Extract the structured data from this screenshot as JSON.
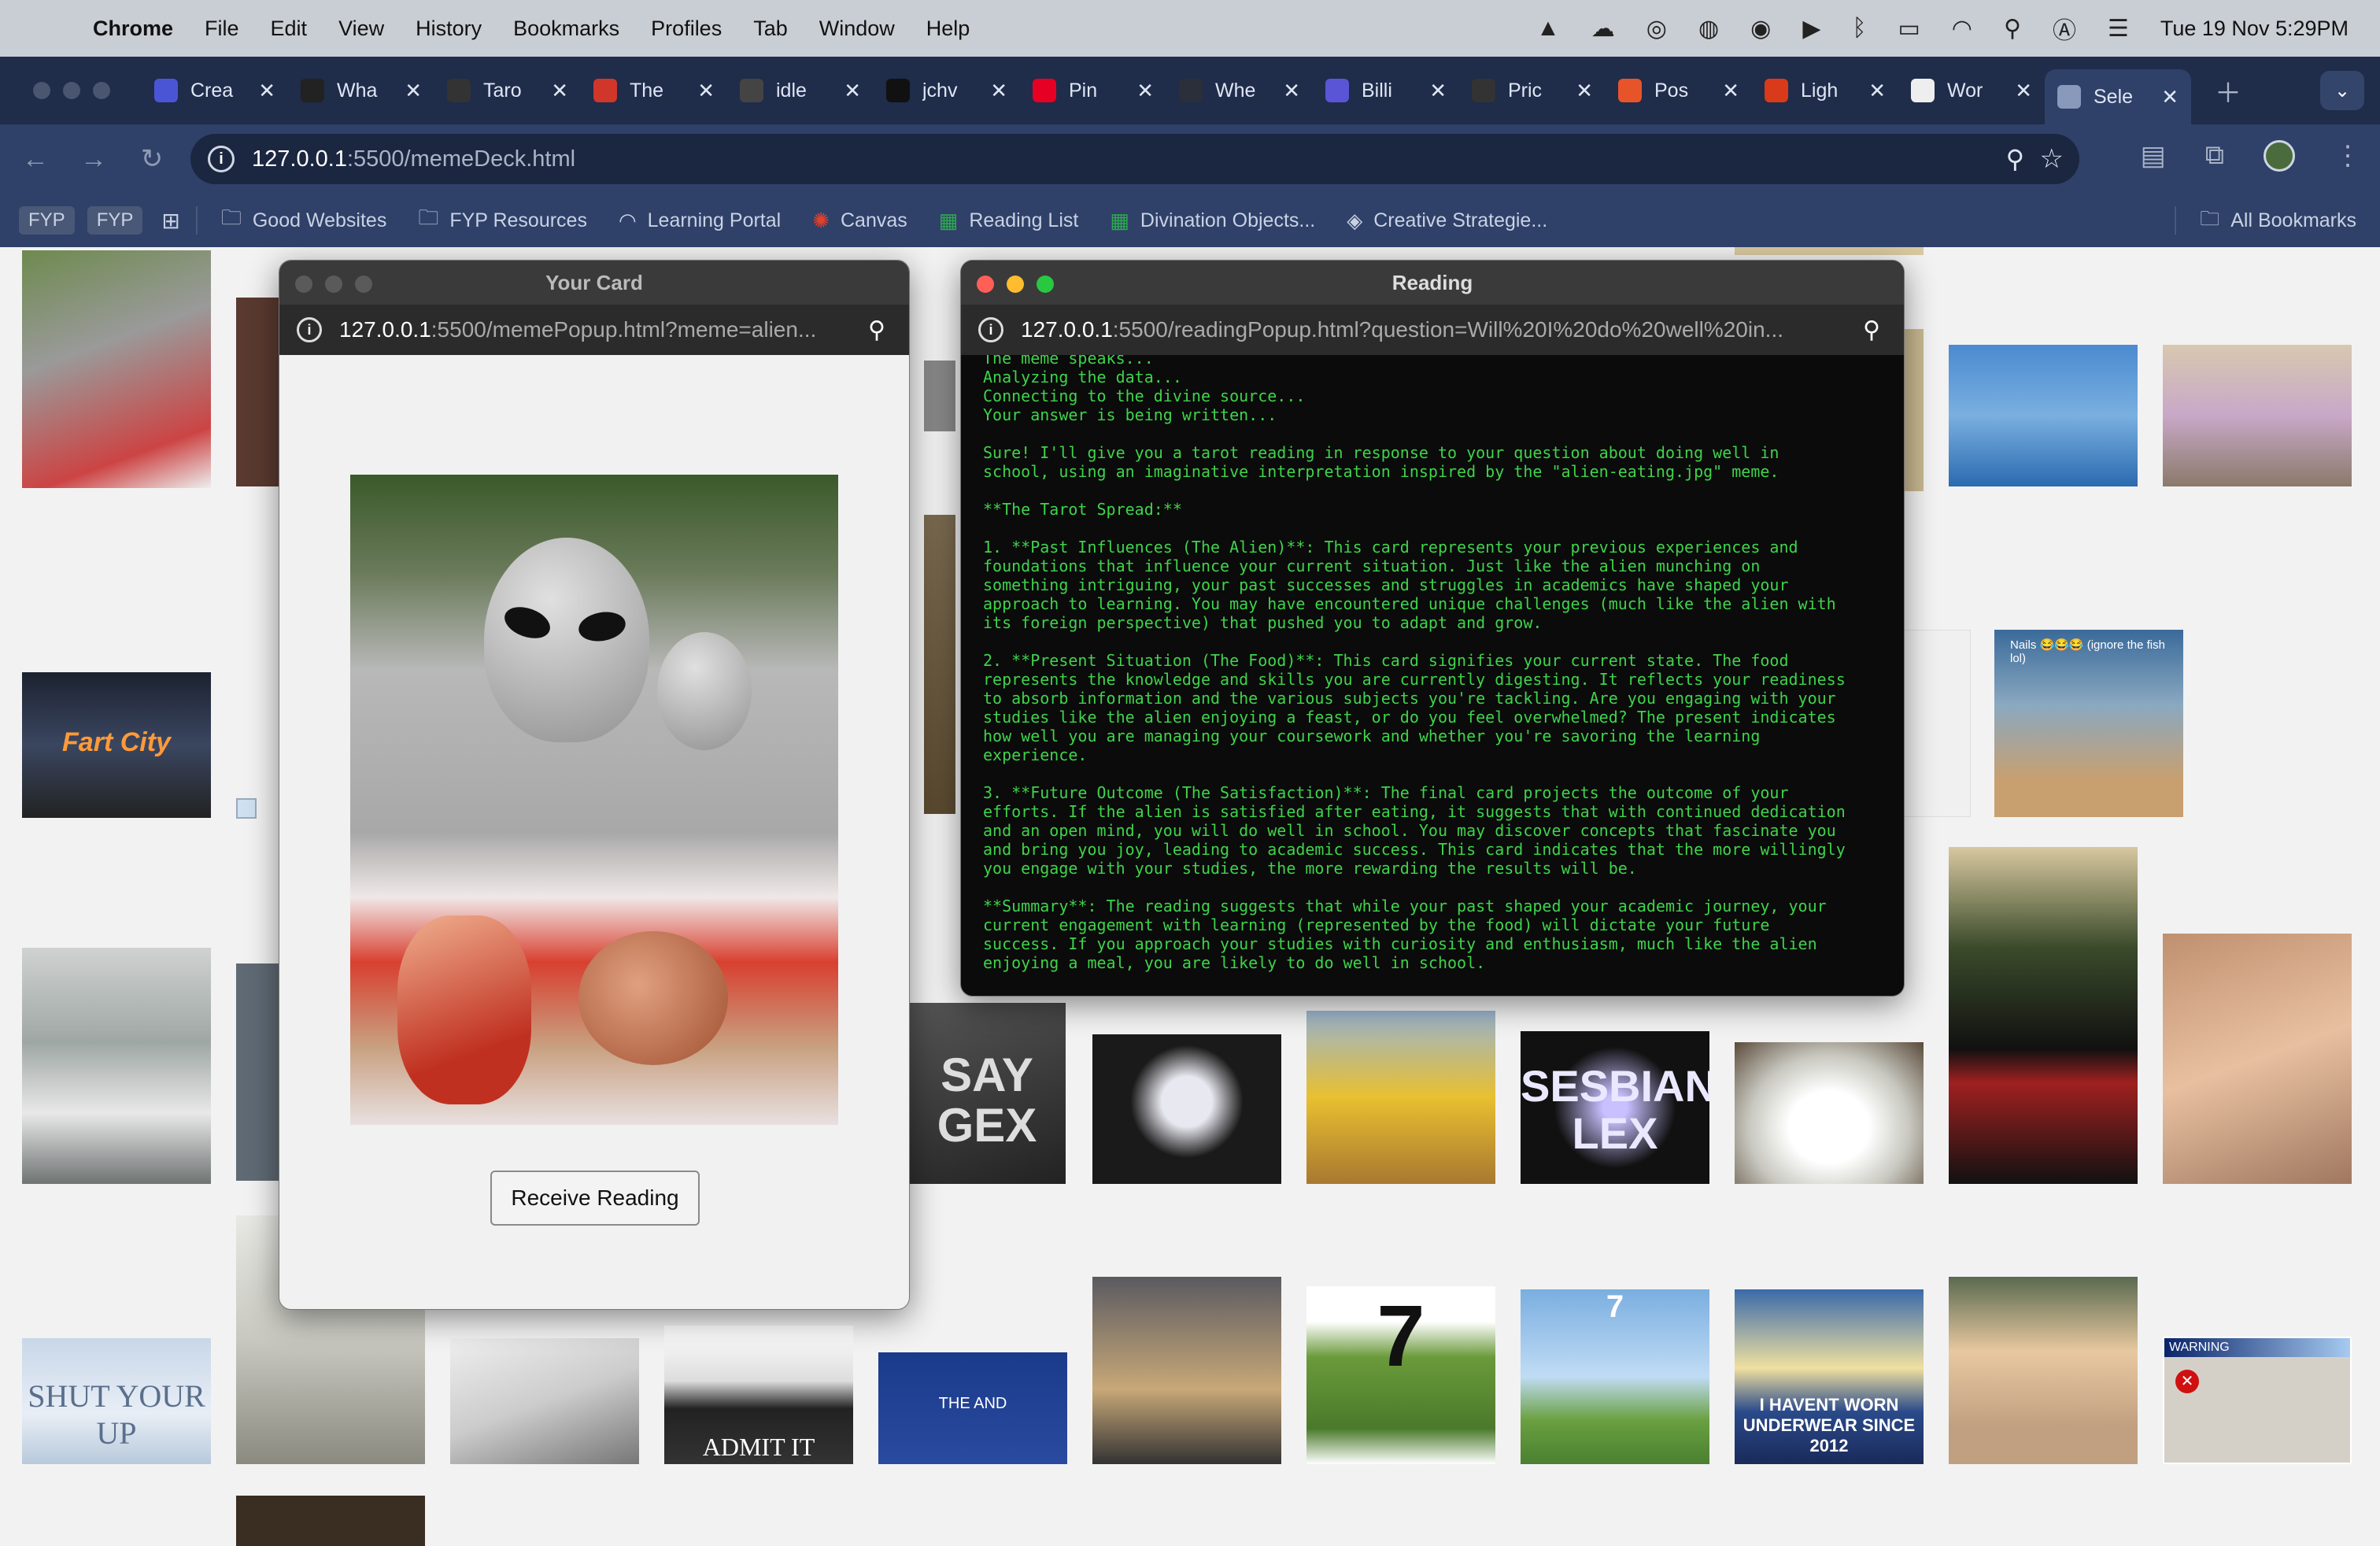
{
  "menubar": {
    "app_name": "Chrome",
    "items": [
      "File",
      "Edit",
      "View",
      "History",
      "Bookmarks",
      "Profiles",
      "Tab",
      "Window",
      "Help"
    ],
    "clock": "Tue 19 Nov  5:29PM"
  },
  "tabs": [
    {
      "label": "Crea",
      "favicon_color": "#4a55d6",
      "icon": "ai-icon"
    },
    {
      "label": "Wha",
      "favicon_color": "#222222",
      "icon": "figma-icon"
    },
    {
      "label": "Taro",
      "favicon_color": "#333333",
      "icon": "openai-icon"
    },
    {
      "label": "The",
      "favicon_color": "#d0362a",
      "icon": "cb-icon"
    },
    {
      "label": "idle",
      "favicon_color": "#444444",
      "icon": "game-icon"
    },
    {
      "label": "jchv",
      "favicon_color": "#111111",
      "icon": "github-icon"
    },
    {
      "label": "Pin",
      "favicon_color": "#e60023",
      "icon": "pinterest-icon"
    },
    {
      "label": "Whe",
      "favicon_color": "#2a2f3a",
      "icon": "doc-icon"
    },
    {
      "label": "Billi",
      "favicon_color": "#5a55d6",
      "icon": "billing-icon"
    },
    {
      "label": "Pric",
      "favicon_color": "#333333",
      "icon": "openai-icon"
    },
    {
      "label": "Pos",
      "favicon_color": "#e8542a",
      "icon": "postman-icon"
    },
    {
      "label": "Ligh",
      "favicon_color": "#d83a1a",
      "icon": "fire-icon"
    },
    {
      "label": "Wor",
      "favicon_color": "#eeeeee",
      "icon": "wikipedia-icon"
    },
    {
      "label": "Sele",
      "favicon_color": "#8899bb",
      "icon": "globe-icon",
      "active": true
    }
  ],
  "omnibox": {
    "host": "127.0.0.1",
    "path": ":5500/memeDeck.html"
  },
  "bookmarks": {
    "chips": [
      "FYP",
      "FYP"
    ],
    "items": [
      "Good Websites",
      "FYP Resources",
      "Learning Portal",
      "Canvas",
      "Reading List",
      "Divination Objects...",
      "Creative Strategie..."
    ],
    "all_bookmarks": "All Bookmarks"
  },
  "card_popup": {
    "title": "Your Card",
    "url_host": "127.0.0.1",
    "url_path": ":5500/memePopup.html?meme=alien...",
    "button_label": "Receive Reading"
  },
  "reading_popup": {
    "title": "Reading",
    "url_host": "127.0.0.1",
    "url_path": ":5500/readingPopup.html?question=Will%20I%20do%20well%20in...",
    "text": "The meme speaks...\nAnalyzing the data...\nConnecting to the divine source...\nYour answer is being written...\n\nSure! I'll give you a tarot reading in response to your question about doing well in\nschool, using an imaginative interpretation inspired by the \"alien-eating.jpg\" meme.\n\n**The Tarot Spread:**\n\n1. **Past Influences (The Alien)**: This card represents your previous experiences and\nfoundations that influence your current situation. Just like the alien munching on\nsomething intriguing, your past successes and struggles in academics have shaped your\napproach to learning. You may have encountered unique challenges (much like the alien with\nits foreign perspective) that pushed you to adapt and grow.\n\n2. **Present Situation (The Food)**: This card signifies your current state. The food\nrepresents the knowledge and skills you are currently digesting. It reflects your readiness\nto absorb information and the various subjects you're tackling. Are you engaging with your\nstudies like the alien enjoying a feast, or do you feel overwhelmed? The present indicates\nhow well you are managing your coursework and whether you're savoring the learning\nexperience.\n\n3. **Future Outcome (The Satisfaction)**: The final card projects the outcome of your\nefforts. If the alien is satisfied after eating, it suggests that with continued dedication\nand an open mind, you will do well in school. You may discover concepts that fascinate you\nand bring you joy, leading to academic success. This card indicates that the more willingly\nyou engage with your studies, the more rewarding the results will be.\n\n**Summary**: The reading suggests that while your past shaped your academic journey, your\ncurrent engagement with learning (represented by the food) will dictate your future\nsuccess. If you approach your studies with curiosity and enthusiasm, much like the alien\nenjoying a meal, you are likely to do well in school."
  },
  "meme_captions": {
    "fart_city": "Fart City",
    "say_gex": "SAY GEX",
    "sesbian_lex": "SESBIAN LEX",
    "the_and": "THE AND",
    "shut_your_up": "SHUT YOUR UP",
    "admit_it": "ADMIT IT",
    "seven_a": "7",
    "seven_b": "7",
    "underwear": "I HAVENT WORN UNDERWEAR SINCE 2012",
    "warning_title": "WARNING",
    "nails": "Nails 😂😂😂 (ignore the fish lol)"
  }
}
